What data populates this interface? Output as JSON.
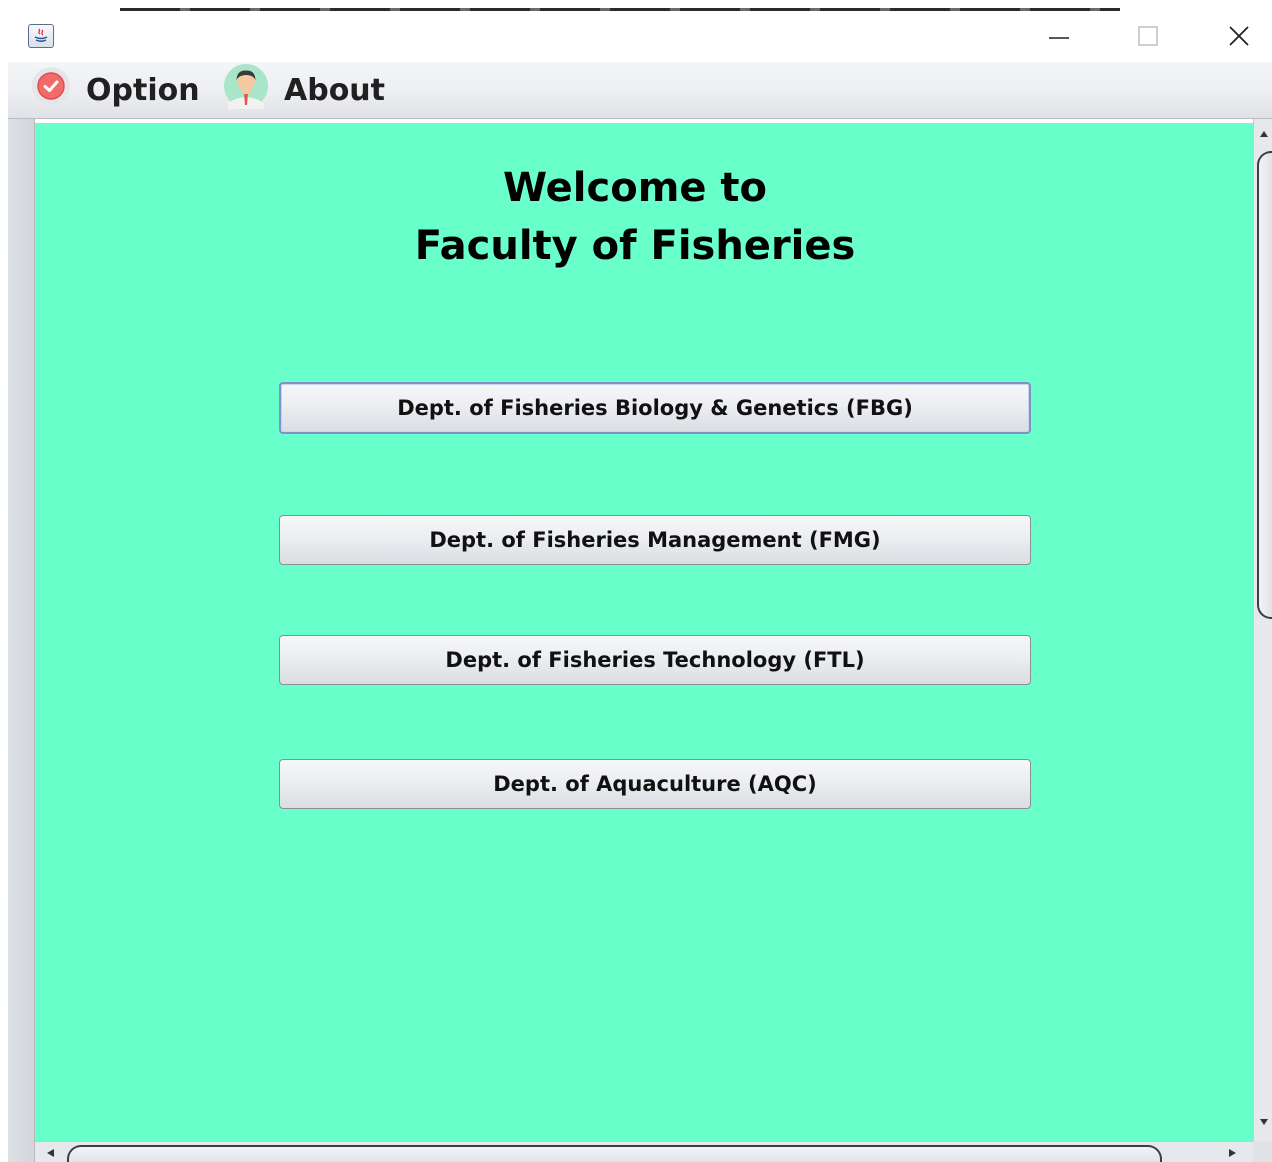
{
  "window": {
    "controls": {
      "minimize_icon": "minimize-icon",
      "maximize_icon": "maximize-icon",
      "close_icon": "close-icon"
    }
  },
  "menu": {
    "items": [
      {
        "label": "Option",
        "icon": "red-check-circle-icon"
      },
      {
        "label": "About",
        "icon": "person-avatar-icon"
      }
    ]
  },
  "main": {
    "welcome_line1": "Welcome to",
    "welcome_line2": "Faculty of Fisheries",
    "background_color": "#69ffca",
    "departments": [
      {
        "label": "Dept. of Fisheries Biology & Genetics (FBG)"
      },
      {
        "label": "Dept. of Fisheries Management (FMG)"
      },
      {
        "label": "Dept. of Fisheries Technology (FTL)"
      },
      {
        "label": "Dept. of Aquaculture (AQC)"
      }
    ]
  }
}
